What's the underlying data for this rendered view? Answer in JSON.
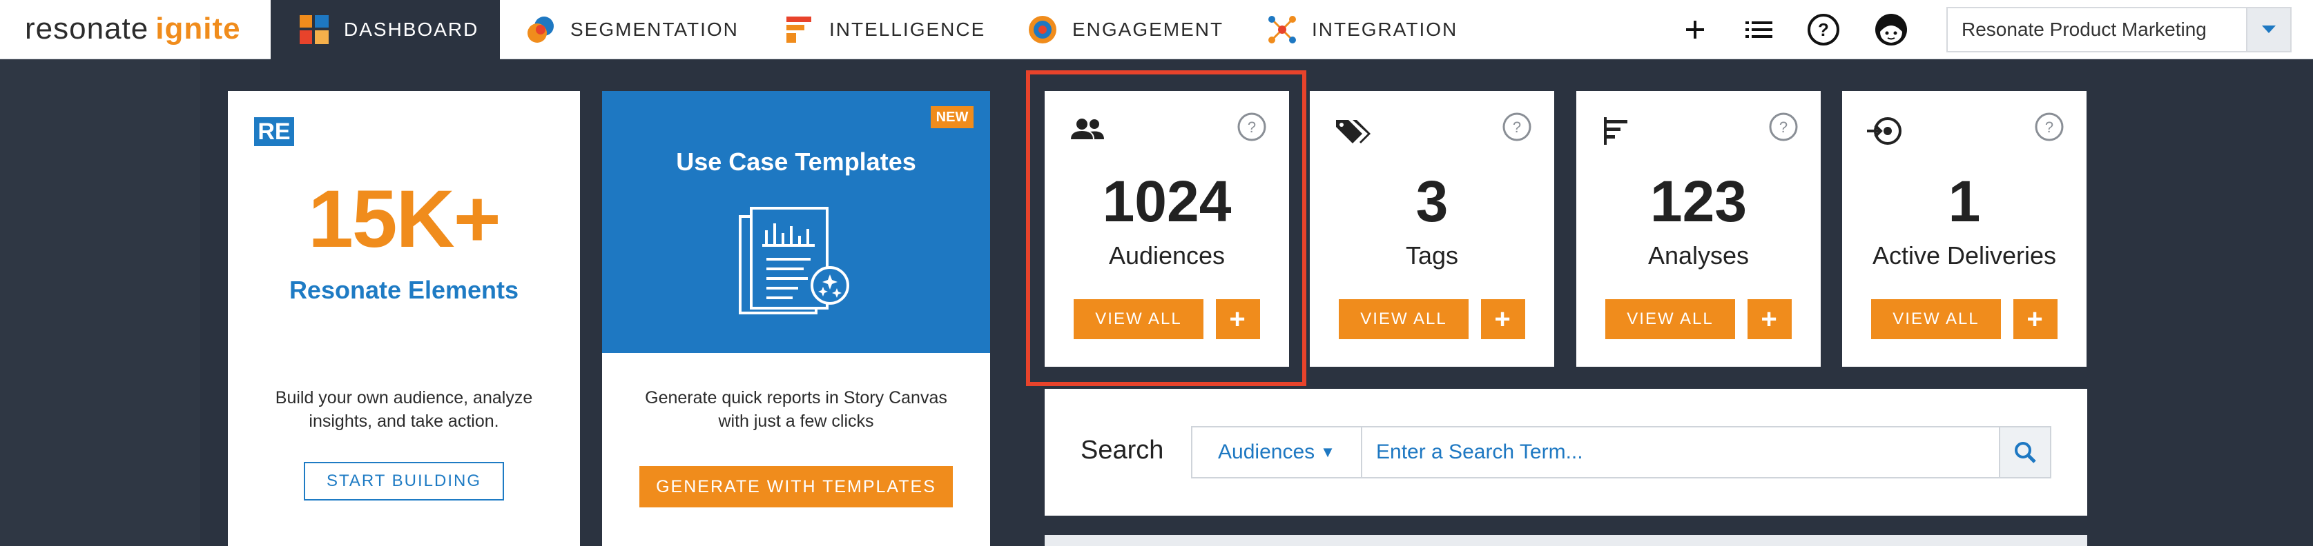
{
  "brand": {
    "name_part1": "resonate",
    "name_part2": "ignite"
  },
  "nav": {
    "tabs": [
      {
        "label": "DASHBOARD",
        "icon": "dashboard-grid-icon",
        "active": true
      },
      {
        "label": "SEGMENTATION",
        "icon": "segmentation-circles-icon",
        "active": false
      },
      {
        "label": "INTELLIGENCE",
        "icon": "intelligence-bars-icon",
        "active": false
      },
      {
        "label": "ENGAGEMENT",
        "icon": "engagement-target-icon",
        "active": false
      },
      {
        "label": "INTEGRATION",
        "icon": "integration-network-icon",
        "active": false
      }
    ],
    "icons": [
      "plus-icon",
      "list-icon",
      "help-icon",
      "user-avatar-icon"
    ],
    "account": "Resonate Product Marketing"
  },
  "elements_card": {
    "badge": "RE",
    "big_number": "15K+",
    "title": "Resonate Elements",
    "description": "Build your own audience, analyze insights, and take action.",
    "button": "START BUILDING"
  },
  "templates_card": {
    "badge": "NEW",
    "title": "Use Case Templates",
    "description": "Generate quick reports in Story Canvas with just a few clicks",
    "button": "GENERATE WITH TEMPLATES"
  },
  "stats": [
    {
      "value": "1024",
      "label": "Audiences",
      "icon": "audiences-people-icon",
      "view": "VIEW ALL",
      "add": "+"
    },
    {
      "value": "3",
      "label": "Tags",
      "icon": "tags-icon",
      "view": "VIEW ALL",
      "add": "+"
    },
    {
      "value": "123",
      "label": "Analyses",
      "icon": "analyses-bars-icon",
      "view": "VIEW ALL",
      "add": "+"
    },
    {
      "value": "1",
      "label": "Active Deliveries",
      "icon": "deliveries-icon",
      "view": "VIEW ALL",
      "add": "+"
    }
  ],
  "search": {
    "label": "Search",
    "scope": "Audiences",
    "placeholder": "Enter a Search Term..."
  },
  "colors": {
    "accent_orange": "#f08c1c",
    "brand_blue": "#1e78c2",
    "nav_dark": "#2b3340",
    "highlight_red": "#e8432b"
  }
}
